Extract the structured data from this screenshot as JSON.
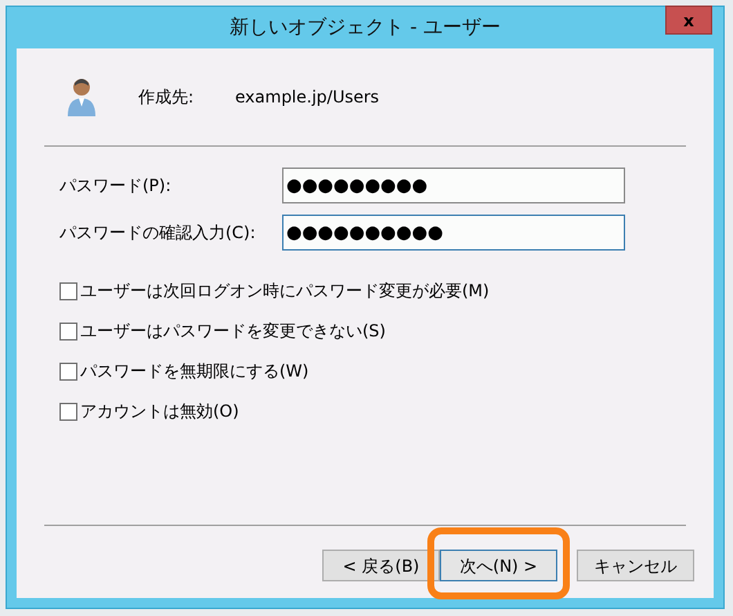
{
  "window": {
    "title": "新しいオブジェクト - ユーザー",
    "close": "x"
  },
  "header": {
    "label": "作成先:",
    "value": "example.jp/Users"
  },
  "fields": [
    {
      "label": "パスワード(P):",
      "value": "●●●●●●●●●",
      "focused": false
    },
    {
      "label": "パスワードの確認入力(C):",
      "value": "●●●●●●●●●●",
      "focused": true
    }
  ],
  "options": [
    {
      "label": "ユーザーは次回ログオン時にパスワード変更が必要(M)",
      "checked": false
    },
    {
      "label": "ユーザーはパスワードを変更できない(S)",
      "checked": false
    },
    {
      "label": "パスワードを無期限にする(W)",
      "checked": false
    },
    {
      "label": "アカウントは無効(O)",
      "checked": false
    }
  ],
  "buttons": [
    {
      "label": "< 戻る(B)",
      "highlighted": false
    },
    {
      "label": "次へ(N) >",
      "highlighted": true
    },
    {
      "label": "キャンセル",
      "highlighted": false
    }
  ]
}
